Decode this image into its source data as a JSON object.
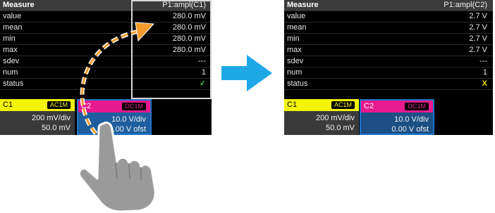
{
  "before": {
    "header": {
      "label": "Measure",
      "source": "P1:ampl(C1)"
    },
    "rows": [
      {
        "label": "value",
        "value": "280.0 mV"
      },
      {
        "label": "mean",
        "value": "280.0 mV"
      },
      {
        "label": "min",
        "value": "280.0 mV"
      },
      {
        "label": "max",
        "value": "280.0 mV"
      },
      {
        "label": "sdev",
        "value": "---"
      },
      {
        "label": "num",
        "value": "1"
      },
      {
        "label": "status",
        "value": "✓"
      }
    ],
    "c1": {
      "name": "C1",
      "coupling": "AC1M",
      "vdiv": "200 mV/div",
      "offset": "50.0 mV"
    },
    "c2": {
      "name": "C2",
      "coupling": "DC1M",
      "vdiv": "10.0 V/div",
      "offset": "0.00 V ofst"
    }
  },
  "after": {
    "header": {
      "label": "Measure",
      "source": "P1:ampl(C2)"
    },
    "rows": [
      {
        "label": "value",
        "value": "2.7 V"
      },
      {
        "label": "mean",
        "value": "2.7 V"
      },
      {
        "label": "min",
        "value": "2.7 V"
      },
      {
        "label": "max",
        "value": "2.7 V"
      },
      {
        "label": "sdev",
        "value": "---"
      },
      {
        "label": "num",
        "value": "1"
      },
      {
        "label": "status",
        "value": "X"
      }
    ],
    "c1": {
      "name": "C1",
      "coupling": "AC1M",
      "vdiv": "200 mV/div",
      "offset": "50.0 mV"
    },
    "c2": {
      "name": "C2",
      "coupling": "DC1M",
      "vdiv": "10.0 V/div",
      "offset": "0.00 V ofst"
    }
  },
  "icons": {
    "arrow": "arrow-right-icon",
    "curve": "curved-dashed-arrow-icon",
    "hand": "pointing-hand-icon"
  },
  "colors": {
    "arrow_blue": "#1fa8e6",
    "curve_orange": "#f39a2a",
    "c1_yellow": "#f4f408",
    "c2_magenta": "#e8198f",
    "selection_blue": "#1f74c9"
  }
}
